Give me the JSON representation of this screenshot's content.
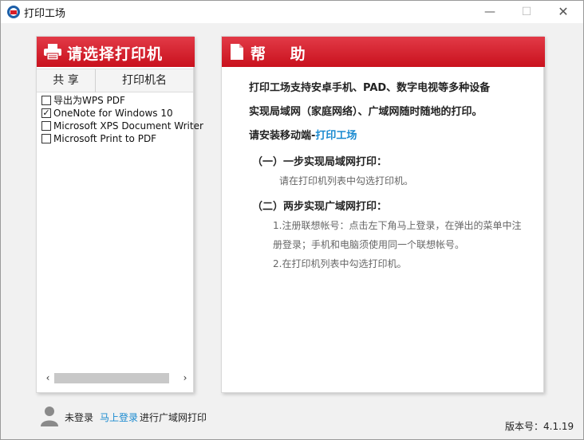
{
  "window": {
    "title": "打印工场",
    "controls": {
      "minimize": "—",
      "maximize": "☐",
      "close": "✕"
    }
  },
  "printer_panel": {
    "title": "请选择打印机",
    "icon": "printer-icon",
    "columns": {
      "share": "共 享",
      "name": "打印机名"
    },
    "printers": [
      {
        "name": "导出为WPS PDF",
        "checked": false
      },
      {
        "name": "OneNote for Windows 10",
        "checked": true
      },
      {
        "name": "Microsoft XPS Document Writer",
        "checked": false
      },
      {
        "name": "Microsoft Print to PDF",
        "checked": false
      }
    ],
    "scroll_left": "‹",
    "scroll_right": "›"
  },
  "help_panel": {
    "title": "帮 助",
    "icon": "document-icon",
    "line1": "打印工场支持安卓手机、PAD、数字电视等多种设备",
    "line2": "实现局域网（家庭网络）、广域网随时随地的打印。",
    "line3_prefix": "请安装移动端-",
    "line3_link": "打印工场",
    "step1_title": "（一）一步实现局域网打印：",
    "step1_note": "请在打印机列表中勾选打印机。",
    "step2_title": "（二）两步实现广域网打印：",
    "step2_note1": "1.注册联想帐号：点击左下角马上登录，在弹出的菜单中注",
    "step2_note2": "册登录；手机和电脑须使用同一个联想帐号。",
    "step2_note3": "2.在打印机列表中勾选打印机。"
  },
  "footer": {
    "not_logged_in": "未登录",
    "login_link": "马上登录",
    "login_suffix": "进行广域网打印",
    "version": "版本号：4.1.19"
  },
  "colors": {
    "accent_red": "#d81e29",
    "link_blue": "#1a8ad0"
  }
}
